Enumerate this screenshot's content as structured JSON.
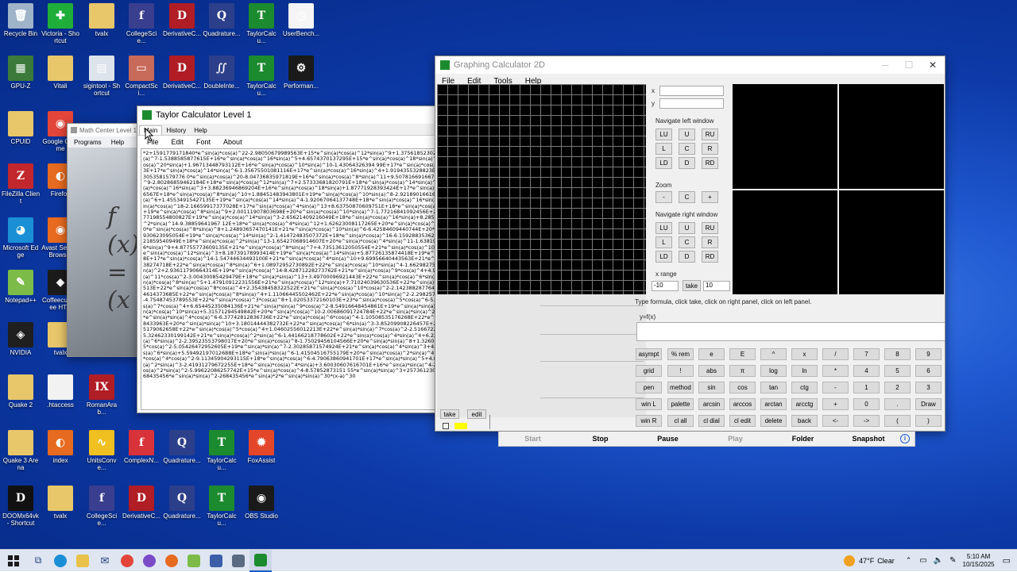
{
  "desktop_icons": [
    {
      "label": "Recycle Bin",
      "glyph": "🗑",
      "color": "#9fb4c9",
      "icon": "recycle-bin-icon"
    },
    {
      "label": "Victoria - Shortcut",
      "glyph": "✚",
      "color": "#1fae3a",
      "icon": "victoria-icon"
    },
    {
      "label": "tvalx",
      "glyph": "",
      "color": "#e8c76a",
      "icon": "folder-icon"
    },
    {
      "label": "CollegeScie...",
      "glyph": "f",
      "color": "#3a3e8f",
      "icon": "tvalx-app-icon"
    },
    {
      "label": "DerivativeC...",
      "glyph": "D",
      "color": "#b01d25",
      "icon": "derivative-app-icon"
    },
    {
      "label": "Quadrature...",
      "glyph": "Q",
      "color": "#2c3f8a",
      "icon": "quadrature-app-icon"
    },
    {
      "label": "TaylorCalcu...",
      "glyph": "T",
      "color": "#1c8a2e",
      "icon": "taylor-app-icon"
    },
    {
      "label": "UserBench...",
      "glyph": "◷",
      "color": "#f5f5f5",
      "icon": "userbench-icon"
    },
    {
      "label": "GPU-Z",
      "glyph": "▦",
      "color": "#3c7a3c",
      "icon": "gpuz-icon"
    },
    {
      "label": "Vitali",
      "glyph": "",
      "color": "#e8c76a",
      "icon": "folder-icon"
    },
    {
      "label": "sigintool - Shortcut",
      "glyph": "▤",
      "color": "#dde3ea",
      "icon": "sigintool-icon"
    },
    {
      "label": "CompactSci...",
      "glyph": "▭",
      "color": "#c86a5a",
      "icon": "compactsci-icon"
    },
    {
      "label": "DerivativeC...",
      "glyph": "D",
      "color": "#b01d25",
      "icon": "derivative-app-icon"
    },
    {
      "label": "DoubleInte...",
      "glyph": "∬",
      "color": "#2c3f8a",
      "icon": "doubleint-app-icon"
    },
    {
      "label": "TaylorCalcu...",
      "glyph": "T",
      "color": "#1c8a2e",
      "icon": "taylor-app-icon"
    },
    {
      "label": "Performan...",
      "glyph": "⚙",
      "color": "#1a1a1a",
      "icon": "performance-icon"
    },
    {
      "label": "CPUID",
      "glyph": "",
      "color": "#e8c76a",
      "icon": "folder-icon"
    },
    {
      "label": "Google Chrome",
      "glyph": "◉",
      "color": "#e3453a",
      "icon": "chrome-icon"
    },
    {
      "label": "FileZilla Client",
      "glyph": "Z",
      "color": "#c1272d",
      "icon": "filezilla-icon"
    },
    {
      "label": "Firefox",
      "glyph": "◐",
      "color": "#e66a1f",
      "icon": "firefox-icon"
    },
    {
      "label": "Microsoft Edge",
      "glyph": "◕",
      "color": "#1a8fd6",
      "icon": "edge-icon"
    },
    {
      "label": "Avast Secure Browser",
      "glyph": "◉",
      "color": "#e86a1e",
      "icon": "avast-icon"
    },
    {
      "label": "Notepad++",
      "glyph": "✎",
      "color": "#7cbb48",
      "icon": "notepadpp-icon"
    },
    {
      "label": "Coffeecup Free HT...",
      "glyph": "◆",
      "color": "#1b1b1b",
      "icon": "coffeecup-icon"
    },
    {
      "label": "NVIDIA",
      "glyph": "◈",
      "color": "#1f1f1f",
      "icon": "nvidia-icon"
    },
    {
      "label": "tvalx",
      "glyph": "",
      "color": "#e8c76a",
      "icon": "folder-icon"
    },
    {
      "label": "Quake 2",
      "glyph": "",
      "color": "#e8c76a",
      "icon": "folder-icon"
    },
    {
      "label": ".htaccess",
      "glyph": "",
      "color": "#f2f2f2",
      "icon": "file-icon"
    },
    {
      "label": "RomanArab...",
      "glyph": "IX",
      "color": "#b01d25",
      "icon": "romanarab-app-icon"
    },
    {
      "label": "Quake 3 Arena",
      "glyph": "",
      "color": "#e8c76a",
      "icon": "folder-icon"
    },
    {
      "label": "index",
      "glyph": "◐",
      "color": "#e66a1f",
      "icon": "firefox-file-icon"
    },
    {
      "label": "UnitsConve...",
      "glyph": "∿",
      "color": "#f0c020",
      "icon": "units-app-icon"
    },
    {
      "label": "ComplexN...",
      "glyph": "f",
      "color": "#d8323a",
      "icon": "complex-app-icon"
    },
    {
      "label": "Quadrature...",
      "glyph": "Q",
      "color": "#2c3f8a",
      "icon": "quadrature-app-icon"
    },
    {
      "label": "TaylorCalcu...",
      "glyph": "T",
      "color": "#1c8a2e",
      "icon": "taylor-app-icon"
    },
    {
      "label": "FoxAssist",
      "glyph": "✹",
      "color": "#e4462a",
      "icon": "foxassist-icon"
    },
    {
      "label": "DOOMx64vk - Shortcut",
      "glyph": "D",
      "color": "#111111",
      "icon": "doom-icon"
    },
    {
      "label": "tvalx",
      "glyph": "",
      "color": "#e8c76a",
      "icon": "zip-folder-icon"
    },
    {
      "label": "CollegeScie...",
      "glyph": "f",
      "color": "#3a3e8f",
      "icon": "tvalx-app-icon"
    },
    {
      "label": "DerivativeC...",
      "glyph": "D",
      "color": "#b01d25",
      "icon": "derivative-app-icon"
    },
    {
      "label": "Quadrature...",
      "glyph": "Q",
      "color": "#2c3f8a",
      "icon": "quadrature-app-icon"
    },
    {
      "label": "TaylorCalcu...",
      "glyph": "T",
      "color": "#1c8a2e",
      "icon": "taylor-app-icon"
    },
    {
      "label": "OBS Studio",
      "glyph": "◉",
      "color": "#1a1a1a",
      "icon": "obs-icon"
    }
  ],
  "math_center": {
    "title": "Math Center Level 1",
    "menu": [
      "Programs",
      "Help"
    ]
  },
  "taylor": {
    "title": "Taylor Calculator Level 1",
    "tabs": [
      "Main",
      "History",
      "Help"
    ],
    "menu": [
      "File",
      "Edit",
      "Font",
      "About"
    ],
    "output": "*2+1591779171840*e^sin(a)*cos(a)^22-2.98050679989563E+15*e^sin(a)*cos(a)^12*sin(a)^9+1.37561852302875E+16*e^sin(a)*cos(a)^14*sin(a)^7-1.5388585877615E+16*e^sin(a)*cos(a)^16*sin(a)^5+4.6574370137295E+15*e^sin(a)*cos(a)^18*sin(a)^3-2.75558432473071 5*e^sin(a)*cos(a)^20*sin(a)+1.96713448793112E+16*e^sin(a)*cos(a)^10*sin(a)^10-1.43064326394 99E+17*e^sin(a)*cos(a)^12*sin(a)^8+2.59625069246293E+17*e^sin(a)*cos(a)^14*sin(a)^6-1.35675501081116E+17*e^sin(a)*cos(a)^16*sin(a)^4+1.9194355328823E+16*e^sin(a)*cos(a)^18*sin(a)^2-3053581579776 0*e^sin(a)*cos(a)^20-8.04736835971819E+16*e^sin(a)*cos(a)^8*sin(a)^11+9.50781669166704E+17*e^sin(a)*cos(a)^10*sin(a)^9-2.80286859462184E+18*e^sin(a)*cos(a)^12*sin(a)^7+2.57333681820791E+18*e^sin(a)*cos(a)^14*sin(a)^5-6.99561119607776E+17*e^sin(a)*cos(a)^16*sin(a)^3+3.88236946869204E+16*e^sin(a)*cos(a)^18*sin(a)+1.87771928393424E+17*e^sin(a)*cos(a)^6*sin(a)^12-3.83591225146567E+18*e^sin(a)*cos(a)^8*sin(a)^10+1.88451483943801E+19*e^sin(a)*cos(a)^10*sin(a)^8-2.92189016616435E+19*e^sin(a)*cos(a)^12*sin(a)^6+1.45534915427135E+19*e^sin(a)*cos(a)^14*sin(a)^4-1.92067064137748E+18*e^sin(a)*cos(a)^16*sin(a)^2+2.99128141371395E+16*e^sin(a)*cos(a)^18-2.16659917377028E+17*e^sin(a)*cos(a)^4*sin(a)^13+8.63750870609751E+18*e^sin(a)*cos(a)^6*sin(a)^11-7.50461807145729E+19*e^sin(a)*cos(a)^8*sin(a)^9+2.00111907803698E+20*e^sin(a)*cos(a)^10*sin(a)^7-1.77216841092456E+20*e^sin(a)*cos(a)^12*sin(a)^5+4.77198554800827E+19*e^sin(a)*cos(a)^14*sin(a)^3-2.65621409216049E+18*e^sin(a)*cos(a)^16*sin(a)+8.28542503044408E+16*e^sin(a)*cos(a)^2*sin(a)^14-9.38859641967 12E+18*e^sin(a)*cos(a)^4*sin(a)^12+1.62623008117265E+20*e^sin(a)*cos(a)^6*sin(a)^10-7.87921668180182E+20*e^sin(a)*cos(a)^8*sin(a)^8+1.24893657470141E+21*e^sin(a)*cos(a)^10*sin(a)^6-6.42584609440744E+20*e^sin(a)*cos(a)^12*sin(a)^4+8.77930623095054E+19*e^sin(a)*cos(a)^14*sin(a)^2-1.41472483507372E+18*e^sin(a)*cos(a)^16-6.1592883536294E+15*e^sin(a)*sin(a)^15+3.68321859540949E+18*e^sin(a)*cos(a)^2*sin(a)^13-1.65427068914607E+20*e^sin(a)*cos(a)^4*sin(a)^11-1.63819681597423E+21*e^sin(a)*cos(a)^6*sin(a)^9+4.87755773609135E+21*e^sin(a)*cos(a)^8*sin(a)^7+4.73513612050554E+21*e^sin(a)*cos(a)^10*sin(a)^5-1.37788700450685E+21*e^sin(a)*cos(a)^12*sin(a)^3+8.18739178993414E+19*e^sin(a)*cos(a)^14*sin(a)+5.87726135874418E+19*e^sin(a)*cos(a)^12-2.16659917377028E+17*e^sin(a)*cos(a)^14-1.54744634493100E+21*e^sin(a)*cos(a)^4*sin(a)^10+9.69956640443563E+21*e^sin(a)*cos(a)^6*sin(a)^8-1.84420838274718E+22*e^sin(a)*cos(a)^8*sin(a)^6+1.08972952730892E+22*e^sin(a)*cos(a)^10*sin(a)^4-1.66298275765977E+21*e^sin(a)*cos(a)^12*sin(a)^2+2.93611790664314E+19*e^sin(a)*cos(a)^14-8.42871228273762E+21*e^sin(a)*cos(a)^9*cos(a)^4+4.91425961166792E+20*e^sin(a)*sin(a)^11*cos(a)^2-3.00430085429479E+18*e^sin(a)*sin(a)^13+3.49700096921443E+22*e^sin(a)*cos(a)^6*sin(a)^7-7.42749450754768E+22*e^sin(a)*cos(a)^8*sin(a)^5+1.47910912231556E+21*e^sin(a)*cos(a)^12*sin(a)+7.71024039630536E+22*e^sin(a)*cos(a)^6*cos(a)^6-7.76395629004513E+22*e^sin(a)*cos(a)^8*cos(a)^4+2.35438458322522E+21*e^sin(a)*cos(a)^10*cos(a)^2-2.14238828776497E+19*e^sin(a)*sin(a)^12-5.95254614373685E+22*e^sin(a)*cos(a)^8*sin(a)^4+1.11066445502462E+22*e^sin(a)*cos(a)^10*sin(a)^2-2.29825743852828E+20*e^sin(a)*cos(a)^12-4.75487453789553E+22*e^sin(a)*cos(a)^3*cos(a)^8+1.02053372160103E+23*e^sin(a)*cos(a)^5*cos(a)^6-5.46611854618812E+22*e^sin(a)*cos(a)^7*cos(a)^4+6.65445235084136E+21*e^sin(a)*sin(a)^9*cos(a)^2-8.54916648454861E+19*e^sin(a)*sin(a)^11+4.06185454440451E+21*e^sin(a)*cos(a)^10*sin(a)+5.31571294549842E+20*e^sin(a)*cos(a)^10-2.00686091724784E+22*e^sin(a)*sin(a)^2*cos(a)^8-7.77527872524289E+22*e^sin(a)*sin(a)^4*cos(a)^6-6.37742812836736E+22*e^sin(a)*cos(a)^6*cos(a)^4-1.10508535176268E+22*e^sin(a)*sin(a)^8*cos(a)^2-1.95241078433963E+20*e^sin(a)*sin(a)^10+3.18014444382732E+22*e^sin(a)*cos(a)^6*sin(a)^3-3.85209908226457E+21*e^sin(a)*cos(a)^8*sin(a)-1.19355179062658E+22*e^sin(a)*cos(a)^5*cos(a)^4+1.04602556012213E+22*e^sin(a)*sin(a)^7*cos(a)^2-2.51667220899602E+20*e^sin(a)*sin(a)^9+5.32462330199142E+21*e^sin(a)*cos(a)^2*sin(a)^6-1.44166218778602E+22*e^sin(a)*cos(a)^4*sin(a)^4+6.22722049429393E+21*e^sin(a)*cos(a)^6*sin(a)^2-2.39523553798017E+20*e^sin(a)*cos(a)^8-1.75029456104566E+20*e^sin(a)*sin(a)^8+1.32607634745806E+21*e^sin(a)*cos(a)^5*cos(a)^2-5.05426472952605E+19*e^sin(a)*sin(a)^7-2.30285871574924E+21*e^sin(a)*cos(a)^4*sin(a)^3+4.79439012050539E+20*e^sin(a)*cos(a)^6*sin(a)+5.59492197012688E+18*e^sin(a)*sin(a)^6-1.41504516755179E+20*e^sin(a)*cos(a)^2*sin(a)^4+1.39097204978711E+20*e^sin(a)*cos(a)^4*cos(a)^2-9.11345904293115E+18*e^sin(a)*cos(a)^6-4.79063860941701E+17*e^sin(a)*sin(a)^5+4.81462355293732E+18*e^sin(a)*cos(a)^2*sin(a)^3-2.41931279672255E+18*e^sin(a)*cos(a)^4*sin(a)+3.60030607616701E+16*e^sin(a)*sin(a)^4-2.60479948079106E+15*e^sin(a)*cos(a)^2*sin(a)^2-5.99622086257742E+15*e^sin(a)*cos(a)^4-8.57852873151 55*e^sin(a)*sin(a)^3+25736123076375*e^sin(a)*cos(a)^2*sin(a)+268435456*e^sin(a)*sin(a)^2-268435456*e^sin(a)*2*e^sin(a)*sin(a)^30*(x-a)^30"
  },
  "graphing": {
    "title": "Graphing Calculator 2D",
    "menu": [
      "File",
      "Edit",
      "Tools",
      "Help"
    ],
    "x_label": "x",
    "y_label": "y",
    "nav_left_title": "Navigate left window",
    "nav_right_title": "Navigate right window",
    "nav_buttons": [
      "LU",
      "U",
      "RU",
      "L",
      "C",
      "R",
      "LD",
      "D",
      "RD"
    ],
    "zoom_title": "Zoom",
    "zoom_buttons": [
      "-",
      "C",
      "+"
    ],
    "xrange_title": "x range",
    "xrange_min": "-10",
    "take_label": "take",
    "xrange_max": "10",
    "hint": "Type formula, click take, click on right panel, click on left panel.",
    "yfx_label": "y=f(x)",
    "left_take": "take",
    "left_edit": "edit",
    "keypad": [
      [
        "asympt",
        "% rem",
        "e",
        "E",
        "^",
        "x",
        "/",
        "7",
        "8",
        "9"
      ],
      [
        "grid",
        "!",
        "abs",
        "π",
        "log",
        "ln",
        "*",
        "4",
        "5",
        "6"
      ],
      [
        "pen",
        "method",
        "sin",
        "cos",
        "tan",
        "ctg",
        "-",
        "1",
        "2",
        "3"
      ],
      [
        "win L",
        "palette",
        "arcsin",
        "arccos",
        "arctan",
        "arcctg",
        "+",
        "0",
        ".",
        "Draw"
      ],
      [
        "win R",
        "cl all",
        "cl dial",
        "cl edit",
        "delete",
        "back",
        "<-",
        "->",
        "(",
        ")"
      ]
    ],
    "bottom_buttons": [
      "Start",
      "Stop",
      "Pause",
      "Play",
      "Folder",
      "Snapshot"
    ],
    "info_glyph": "i"
  },
  "taskbar": {
    "weather_temp": "47°F",
    "weather_desc": "Clear",
    "time": "5:10 AM",
    "date": "10/15/2025"
  }
}
